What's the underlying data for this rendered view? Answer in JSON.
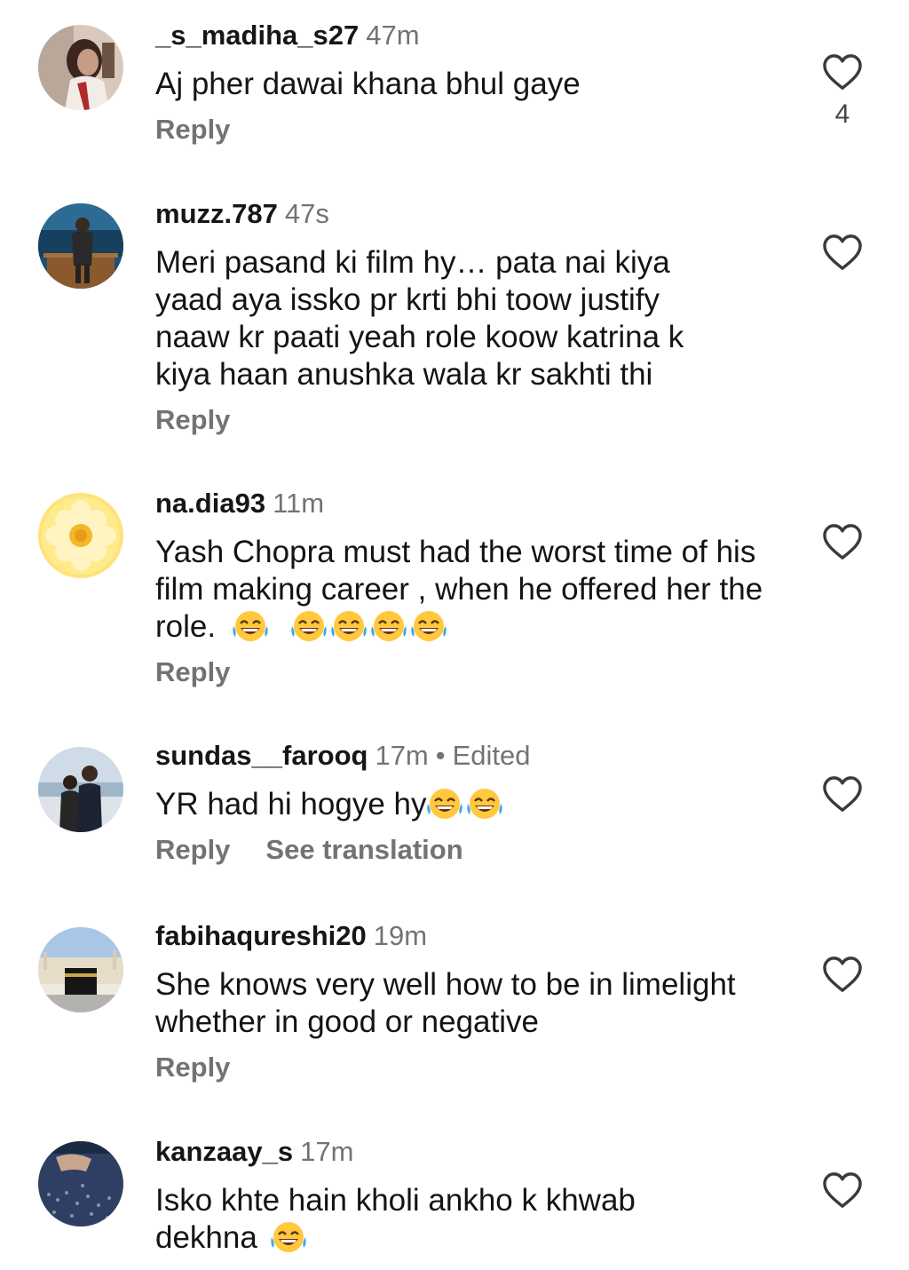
{
  "comments": [
    {
      "username": "_s_madiha_s27",
      "time": "47m",
      "text": "Aj pher dawai khana bhul gaye",
      "reply_label": "Reply",
      "like_count": "4",
      "avatar_icon": "avatar-woman-photo"
    },
    {
      "username": "muzz.787",
      "time": "47s",
      "text": "Meri pasand ki film hy… pata nai kiya yaad aya issko pr krti bhi toow justify naaw kr paati yeah role koow katrina k kiya haan anushka wala kr sakhti thi",
      "reply_label": "Reply",
      "avatar_icon": "avatar-man-sea-photo"
    },
    {
      "username": "na.dia93",
      "time": "11m",
      "text": "Yash Chopra must had the worst time of his film making career , when he offered her the role.",
      "emoji": "face-with-tears-of-joy",
      "reply_label": "Reply",
      "avatar_icon": "avatar-yellow-flower"
    },
    {
      "username": "sundas__farooq",
      "time": "17m",
      "separator": "•",
      "edited_label": "Edited",
      "text": "YR had hi hogye hy",
      "emoji": "face-with-tears-of-joy",
      "reply_label": "Reply",
      "translation_label": "See translation",
      "avatar_icon": "avatar-couple-photo"
    },
    {
      "username": "fabihaqureshi20",
      "time": "19m",
      "text": "She knows very well how to be in limelight whether in good or negative",
      "reply_label": "Reply",
      "avatar_icon": "avatar-kaaba-photo"
    },
    {
      "username": "kanzaay_s",
      "time": "17m",
      "text": "Isko khte hain kholi ankho k khwab dekhna",
      "emoji": "face-with-tears-of-joy",
      "avatar_icon": "avatar-fabric-photo"
    }
  ],
  "colors": {
    "username": "#161616",
    "muted": "#737373",
    "text": "#141414",
    "emoji_face": "#FFC83D",
    "emoji_tears": "#3FA8E8"
  },
  "icons": {
    "like": "heart-outline-icon"
  }
}
